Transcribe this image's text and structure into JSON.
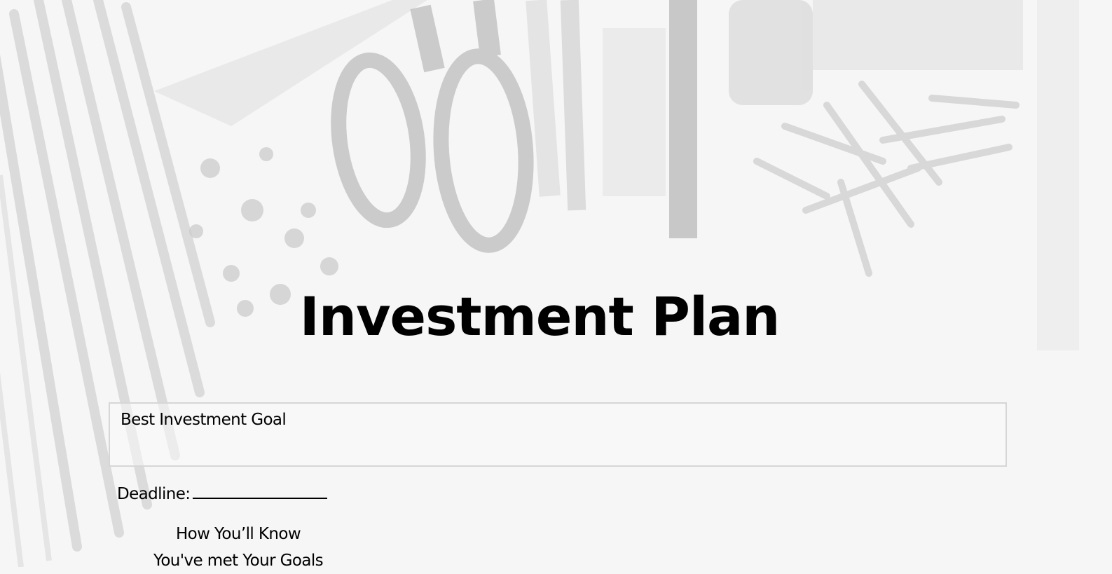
{
  "document": {
    "title": "Investment Plan",
    "goal_box": {
      "label": "Best Investment Goal"
    },
    "deadline": {
      "label": "Deadline:"
    },
    "how_know": {
      "line1": "How You’ll Know",
      "line2": "You've met Your Goals"
    }
  },
  "colors": {
    "background": "#f6f6f6",
    "box_border": "#d6d6d6",
    "text": "#000000"
  },
  "background_image": "faded grayscale office supplies photo (scissors, pencils, push pins, clothespins, ruler)"
}
